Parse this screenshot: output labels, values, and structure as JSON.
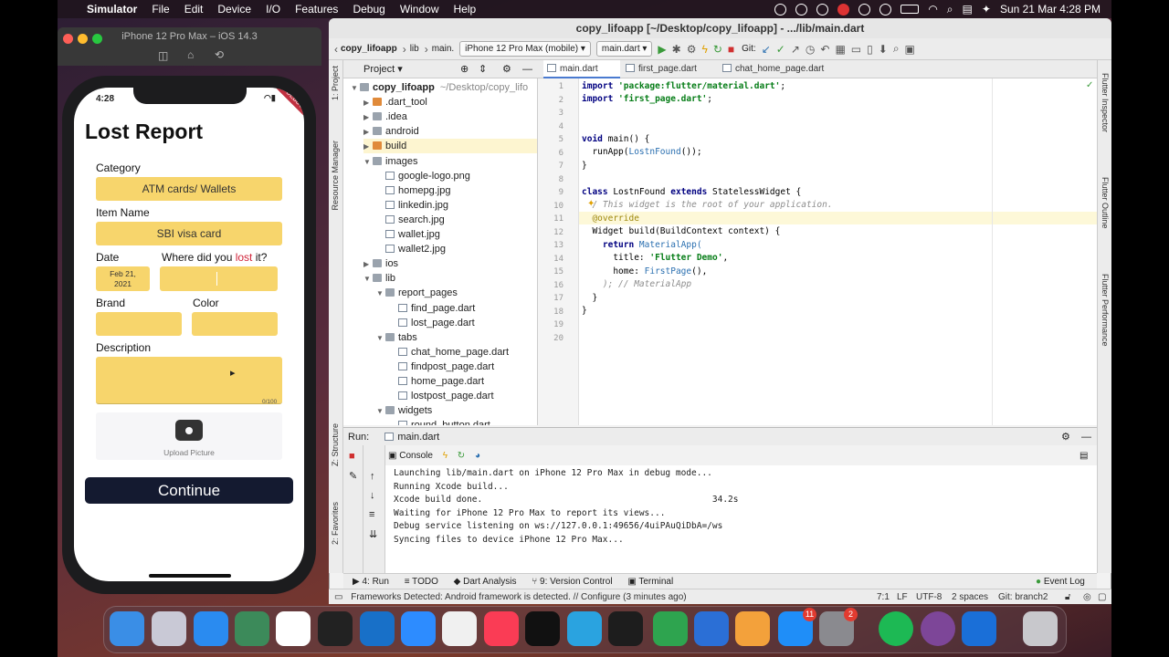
{
  "menubar": {
    "app": "Simulator",
    "items": [
      "File",
      "Edit",
      "Device",
      "I/O",
      "Features",
      "Debug",
      "Window",
      "Help"
    ],
    "clock": "Sun 21 Mar  4:28 PM"
  },
  "simulator": {
    "title": "iPhone 12 Pro Max – iOS 14.3",
    "time": "4:28",
    "debug_banner": "DEBUG",
    "page_title": "Lost Report",
    "category_label": "Category",
    "category_value": "ATM cards/ Wallets",
    "item_label": "Item Name",
    "item_value": "SBI visa card",
    "date_label": "Date",
    "where_label_1": "Where did you ",
    "where_label_2": "lost",
    "where_label_3": " it?",
    "date_value_1": "Feb 21,",
    "date_value_2": "2021",
    "brand_label": "Brand",
    "color_label": "Color",
    "description_label": "Description",
    "counter": "0/100",
    "upload_label": "Upload Picture",
    "continue_label": "Continue"
  },
  "ide": {
    "title": "copy_lifoapp [~/Desktop/copy_lifoapp] - .../lib/main.dart",
    "breadcrumb": [
      "copy_lifoapp",
      "lib",
      "main."
    ],
    "device": "iPhone 12 Pro Max (mobile)",
    "run_config": "main.dart",
    "git_label": "Git:",
    "project_header": "Project",
    "left_strip": [
      "1: Project",
      "Resource Manager",
      "Z: Structure",
      "2: Favorites"
    ],
    "right_strip": [
      "Flutter Inspector",
      "Flutter Outline",
      "Flutter Performance"
    ],
    "tree": [
      {
        "label": "copy_lifoapp",
        "extra": "~/Desktop/copy_lifo",
        "depth": 0,
        "open": true,
        "type": "folder",
        "bold": true
      },
      {
        "label": ".dart_tool",
        "depth": 1,
        "open": false,
        "type": "folder"
      },
      {
        "label": ".idea",
        "depth": 1,
        "open": false,
        "type": "folder"
      },
      {
        "label": "android",
        "depth": 1,
        "open": false,
        "type": "folder"
      },
      {
        "label": "build",
        "depth": 1,
        "open": false,
        "type": "folder"
      },
      {
        "label": "images",
        "depth": 1,
        "open": true,
        "type": "folder"
      },
      {
        "label": "google-logo.png",
        "depth": 2,
        "type": "file"
      },
      {
        "label": "homepg.jpg",
        "depth": 2,
        "type": "file"
      },
      {
        "label": "linkedin.jpg",
        "depth": 2,
        "type": "file"
      },
      {
        "label": "search.jpg",
        "depth": 2,
        "type": "file"
      },
      {
        "label": "wallet.jpg",
        "depth": 2,
        "type": "file"
      },
      {
        "label": "wallet2.jpg",
        "depth": 2,
        "type": "file"
      },
      {
        "label": "ios",
        "depth": 1,
        "open": false,
        "type": "folder"
      },
      {
        "label": "lib",
        "depth": 1,
        "open": true,
        "type": "folder"
      },
      {
        "label": "report_pages",
        "depth": 2,
        "open": true,
        "type": "folder"
      },
      {
        "label": "find_page.dart",
        "depth": 3,
        "type": "file"
      },
      {
        "label": "lost_page.dart",
        "depth": 3,
        "type": "file"
      },
      {
        "label": "tabs",
        "depth": 2,
        "open": true,
        "type": "folder"
      },
      {
        "label": "chat_home_page.dart",
        "depth": 3,
        "type": "file"
      },
      {
        "label": "findpost_page.dart",
        "depth": 3,
        "type": "file"
      },
      {
        "label": "home_page.dart",
        "depth": 3,
        "type": "file"
      },
      {
        "label": "lostpost_page.dart",
        "depth": 3,
        "type": "file"
      },
      {
        "label": "widgets",
        "depth": 2,
        "open": true,
        "type": "folder"
      },
      {
        "label": "round_button.dart",
        "depth": 3,
        "type": "file"
      }
    ],
    "tabs": [
      "main.dart",
      "first_page.dart",
      "chat_home_page.dart"
    ],
    "line_numbers": [
      "1",
      "2",
      "3",
      "4",
      "5",
      "6",
      "7",
      "8",
      "9",
      "10",
      "11",
      "12",
      "13",
      "14",
      "15",
      "16",
      "17",
      "18",
      "19",
      "20"
    ],
    "code": {
      "l1a": "import ",
      "l1b": "'package:flutter/material.dart'",
      "l2a": "import ",
      "l2b": "'first_page.dart'",
      "l5a": "void ",
      "l5b": "main() {",
      "l6a": "  runApp(",
      "l6b": "LostnFound",
      "l6c": "());",
      "l7": "}",
      "l9a": "class ",
      "l9b": "LostnFound ",
      "l9c": "extends ",
      "l9d": "StatelessWidget {",
      "l10": "  / This widget is the root of your application.",
      "l11": "  @override",
      "l12": "  Widget build(BuildContext context) {",
      "l13a": "    return ",
      "l13b": "MaterialApp(",
      "l14a": "      title: ",
      "l14b": "'Flutter Demo'",
      "l15a": "      home: ",
      "l15b": "FirstPage",
      "l15c": "(),",
      "l16": "    ); // MaterialApp",
      "l17": "  }",
      "l18": "}"
    },
    "run_label": "Run:",
    "run_tab": "main.dart",
    "console_tab": "Console",
    "console_lines": [
      "Launching lib/main.dart on iPhone 12 Pro Max in debug mode...",
      "Running Xcode build...",
      "Xcode build done.                                            34.2s",
      "Waiting for iPhone 12 Pro Max to report its views...",
      "Debug service listening on ws://127.0.0.1:49656/4uiPAuQiDbA=/ws",
      "Syncing files to device iPhone 12 Pro Max..."
    ],
    "bottom_tabs": [
      "4: Run",
      "TODO",
      "Dart Analysis",
      "9: Version Control",
      "Terminal"
    ],
    "event_log": "Event Log",
    "status_message": "Frameworks Detected: Android framework is detected. // Configure (3 minutes ago)",
    "status_right": [
      "7:1",
      "LF",
      "UTF-8",
      "2 spaces",
      "Git: branch2"
    ]
  },
  "dock": {
    "badges": {
      "appstore": "11",
      "prefs": "2"
    },
    "icons": [
      "finder-icon",
      "launchpad-icon",
      "safari-icon",
      "android-studio-icon",
      "slack-icon",
      "terminal-icon",
      "trello-icon",
      "zoom-icon",
      "photos-icon",
      "music-icon",
      "tv-icon",
      "telegram-icon",
      "pycharm-icon",
      "numbers-icon",
      "keynote-icon",
      "pages-icon",
      "app-store-icon",
      "system-preferences-icon",
      "spotify-icon",
      "tor-icon",
      "xcode-icon",
      "trash-icon"
    ]
  }
}
